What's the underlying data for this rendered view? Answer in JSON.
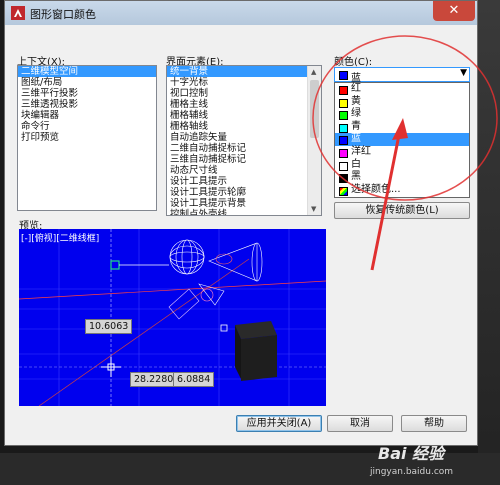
{
  "dialog": {
    "title": "图形窗口颜色",
    "close_label": "✕"
  },
  "context": {
    "label": "上下文(X):",
    "items": [
      "二维模型空间",
      "图纸/布局",
      "三维平行投影",
      "三维透视投影",
      "块编辑器",
      "命令行",
      "打印预览"
    ],
    "selected_index": 0
  },
  "elements": {
    "label": "界面元素(E):",
    "items": [
      "统一背景",
      "十字光标",
      "视口控制",
      "栅格主线",
      "栅格辅线",
      "栅格轴线",
      "自动追踪矢量",
      "二维自动捕捉标记",
      "三维自动捕捉标记",
      "动态尺寸线",
      "设计工具提示",
      "设计工具提示轮廓",
      "设计工具提示背景",
      "控制点外壳线",
      "光线轮廓"
    ],
    "selected_index": 0
  },
  "color": {
    "label": "颜色(C):",
    "selected": "蓝",
    "selected_swatch": "#0000ff",
    "options": [
      {
        "label": "红",
        "swatch": "#ff0000"
      },
      {
        "label": "黄",
        "swatch": "#ffff00"
      },
      {
        "label": "绿",
        "swatch": "#00ff00"
      },
      {
        "label": "青",
        "swatch": "#00ffff"
      },
      {
        "label": "蓝",
        "swatch": "#0000ff"
      },
      {
        "label": "洋红",
        "swatch": "#ff00ff"
      },
      {
        "label": "白",
        "swatch": "#ffffff"
      },
      {
        "label": "黑",
        "swatch": "#000000"
      },
      {
        "label": "选择颜色...",
        "swatch": "multi"
      }
    ],
    "highlighted_index": 4,
    "restore_button": "恢复传统颜色(L)"
  },
  "preview": {
    "label": "预览:",
    "overlay_text": "[-][俯视][二维线框]",
    "readout_a": "10.6063",
    "readout_b": "28.2280",
    "readout_c": "6.0884"
  },
  "buttons": {
    "apply_close": "应用并关闭(A)",
    "cancel": "取消",
    "help": "帮助"
  },
  "watermark": {
    "brand": "Bai 经验",
    "url": "jingyan.baidu.com"
  },
  "colors": {
    "accent": "#3399ff",
    "preview_bg": "#0000ee",
    "annotation_red": "#e03030"
  }
}
